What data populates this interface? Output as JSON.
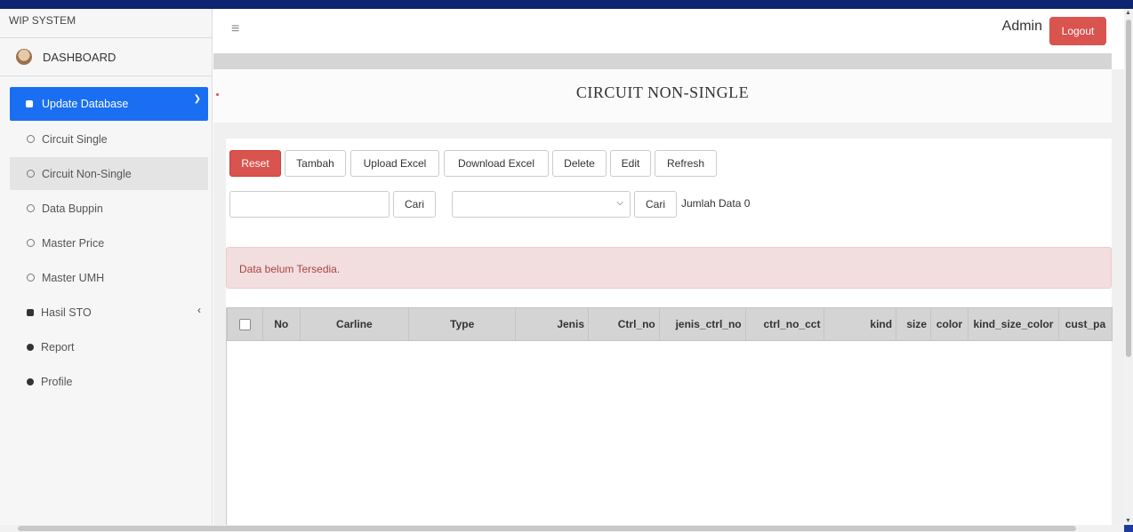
{
  "app": {
    "brand": "WIP SYSTEM"
  },
  "sidebar": {
    "user_label": "DASHBOARD",
    "active_group": "Update Database",
    "items": [
      {
        "label": "Circuit Single"
      },
      {
        "label": "Circuit Non-Single"
      },
      {
        "label": "Data Buppin"
      },
      {
        "label": "Master Price"
      },
      {
        "label": "Master UMH"
      },
      {
        "label": "Hasil STO"
      },
      {
        "label": "Report"
      },
      {
        "label": "Profile"
      }
    ]
  },
  "header": {
    "menu_icon": "hamburger-icon",
    "user": "Admin",
    "logout": "Logout"
  },
  "page": {
    "title": "CIRCUIT NON-SINGLE"
  },
  "toolbar": {
    "reset": "Reset",
    "tambah": "Tambah",
    "upload": "Upload Excel",
    "download": "Download Excel",
    "delete": "Delete",
    "edit": "Edit",
    "refresh": "Refresh"
  },
  "search": {
    "input_value": "",
    "cari1": "Cari",
    "select_value": "",
    "cari2": "Cari",
    "count_label": "Jumlah Data 0"
  },
  "alert": {
    "message": "Data belum Tersedia."
  },
  "table": {
    "columns": [
      "No",
      "Carline",
      "Type",
      "Jenis",
      "Ctrl_no",
      "jenis_ctrl_no",
      "ctrl_no_cct",
      "kind",
      "size",
      "color",
      "kind_size_color",
      "cust_pa"
    ]
  },
  "colors": {
    "primary": "#1a6ef2",
    "danger": "#d9534f",
    "alert_bg": "#f2dede",
    "alert_text": "#a94442"
  }
}
